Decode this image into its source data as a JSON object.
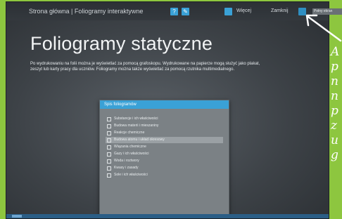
{
  "app": {
    "title": "Strona główna | Foliogramy interaktywne"
  },
  "toolbar": {
    "help_icon_label": "?",
    "edit_icon_label": "✎",
    "more_label": "Więcej",
    "close_label": "Zamknij",
    "tooltip_text": "Pełny ekran"
  },
  "main": {
    "title": "Foliogramy statyczne",
    "description": "Po wydrukowaniu na folii można je wyświetlać za pomocą grafoskopu. Wydrukowane na papierze mogą służyć jako plakat, zeszyt lub karty pracy dla uczniów. Foliogramy można także wyświetlać za pomocą rzutnika multimedialnego."
  },
  "panel": {
    "header": "Spis foliogramów",
    "items": [
      {
        "label": "Substancje i ich właściwości"
      },
      {
        "label": "Budowa materii i mieszaniny"
      },
      {
        "label": "Reakcje chemiczne"
      },
      {
        "label": "Budowa atomu i układ okresowy"
      },
      {
        "label": "Wiązania chemiczne"
      },
      {
        "label": "Gazy i ich właściwości"
      },
      {
        "label": "Woda i roztwory"
      },
      {
        "label": "Kwasy i zasady"
      },
      {
        "label": "Sole i ich właściwości"
      }
    ]
  },
  "annotation": {
    "letters": [
      "A",
      "p",
      "n",
      "n",
      "p",
      "z",
      "u",
      "g"
    ]
  },
  "colors": {
    "accent": "#3aa1d6",
    "frame": "#8dc63f"
  }
}
